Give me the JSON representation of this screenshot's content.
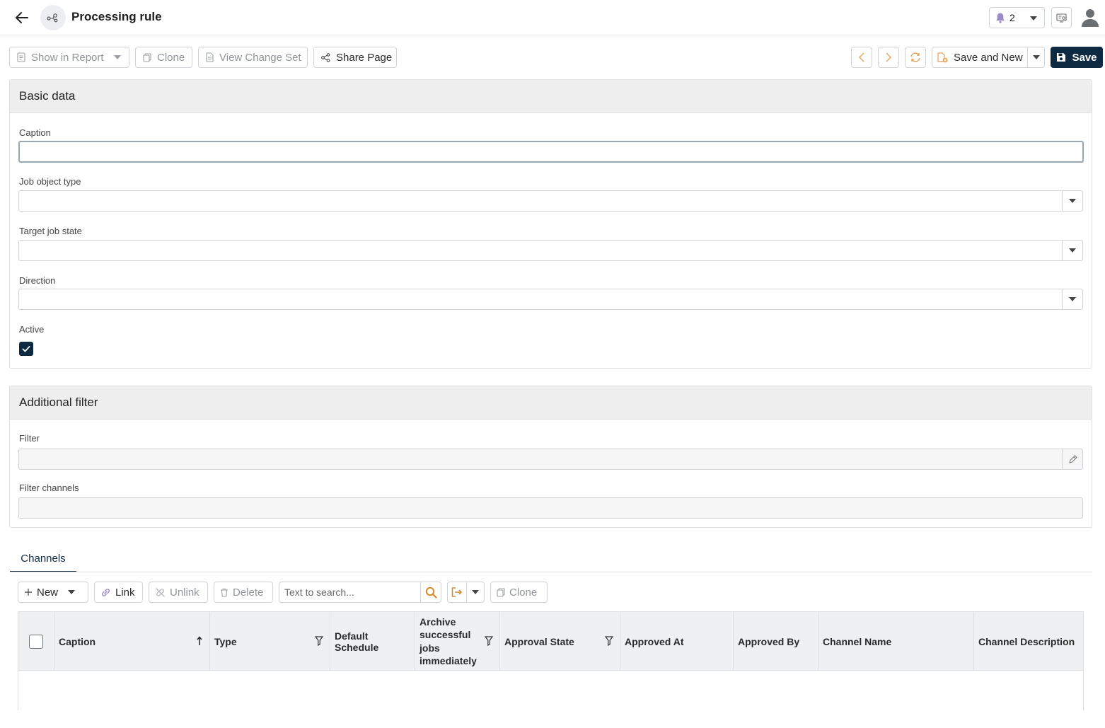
{
  "header": {
    "title": "Processing rule",
    "notification_count": "2"
  },
  "toolbar": {
    "show_in_report": "Show in Report",
    "clone": "Clone",
    "view_change_set": "View Change Set",
    "share_page": "Share Page",
    "save_and_new": "Save and New",
    "save": "Save"
  },
  "basic_data": {
    "title": "Basic data",
    "caption_label": "Caption",
    "caption_value": "",
    "job_object_type_label": "Job object type",
    "job_object_type_value": "",
    "target_job_state_label": "Target job state",
    "target_job_state_value": "",
    "direction_label": "Direction",
    "direction_value": "",
    "active_label": "Active",
    "active_checked": true
  },
  "additional_filter": {
    "title": "Additional filter",
    "filter_label": "Filter",
    "filter_value": "",
    "filter_channels_label": "Filter channels",
    "filter_channels_value": ""
  },
  "tabs": [
    {
      "label": "Channels",
      "active": true
    }
  ],
  "channels_toolbar": {
    "new": "New",
    "link": "Link",
    "unlink": "Unlink",
    "delete": "Delete",
    "search_placeholder": "Text to search...",
    "clone": "Clone"
  },
  "grid": {
    "columns": [
      "Caption",
      "Type",
      "Default Schedule",
      "Archive successful jobs immediately",
      "Approval State",
      "Approved At",
      "Approved By",
      "Channel Name",
      "Channel Description"
    ],
    "rows": []
  },
  "colors": {
    "primary": "#0d2a42",
    "accent_orange": "#e8a15a",
    "bell_purple": "#9b8bc4"
  }
}
